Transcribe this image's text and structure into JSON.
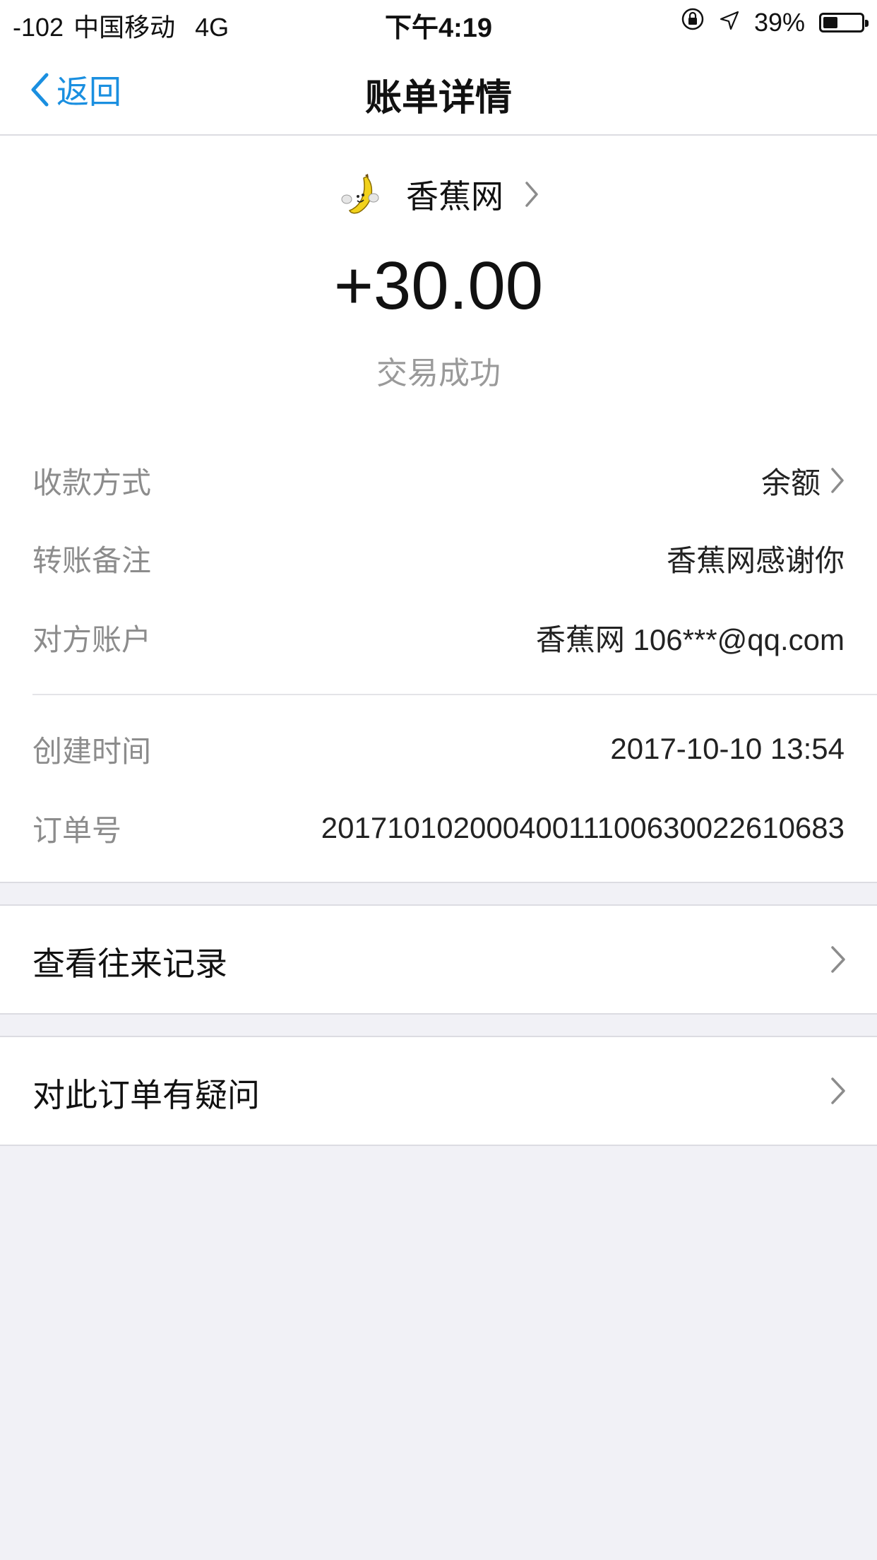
{
  "status_bar": {
    "signal": "-102",
    "carrier": "中国移动",
    "network": "4G",
    "time": "下午4:19",
    "battery_percent": "39%",
    "battery_level": 0.39
  },
  "nav": {
    "back_label": "返回",
    "title": "账单详情"
  },
  "merchant": {
    "name": "香蕉网"
  },
  "amount": "+30.00",
  "status": "交易成功",
  "details": [
    {
      "label": "收款方式",
      "value": "余额"
    },
    {
      "label": "转账备注",
      "value": "香蕉网感谢你"
    },
    {
      "label": "对方账户",
      "value": "香蕉网 106***@qq.com"
    },
    {
      "label": "创建时间",
      "value": "2017-10-10 13:54"
    },
    {
      "label": "订单号",
      "value": "20171010200040011100630022610683"
    }
  ],
  "actions": {
    "history_label": "查看往来记录",
    "question_label": "对此订单有疑问"
  },
  "colors": {
    "accent": "#1a8fe0",
    "background": "#f1f1f6",
    "label_gray": "#8c8c8c"
  }
}
